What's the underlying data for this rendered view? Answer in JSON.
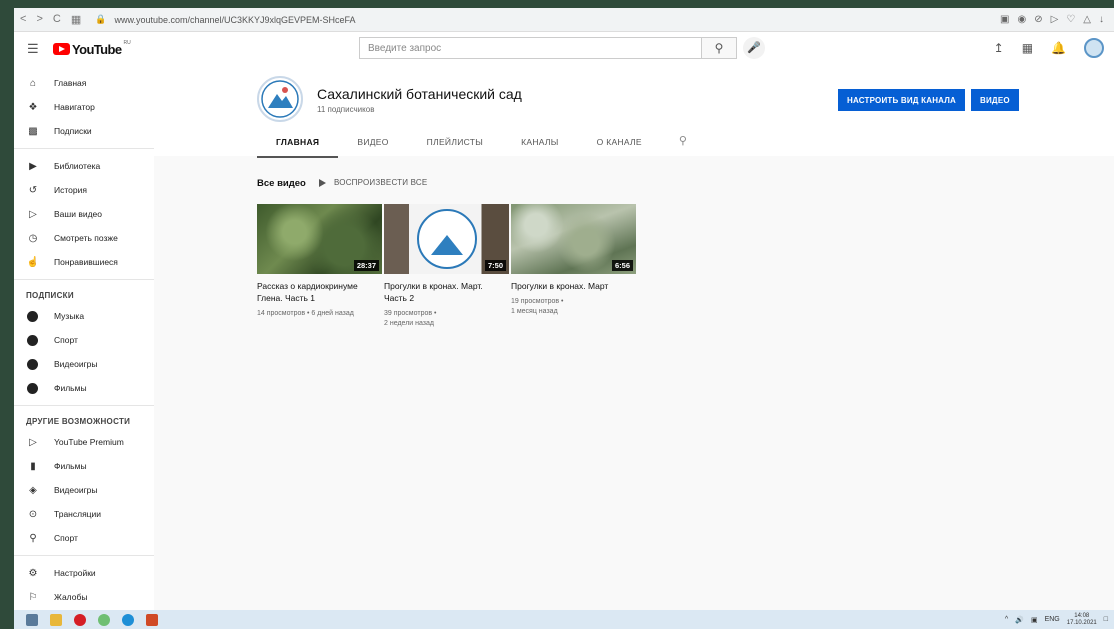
{
  "browser": {
    "url": "www.youtube.com/channel/UC3KKYJ9xlqGEVPEM-SHceFA"
  },
  "header": {
    "logo_text": "YouTube",
    "logo_region": "RU",
    "search_placeholder": "Введите запрос"
  },
  "sidebar": {
    "main": [
      {
        "label": "Главная",
        "icon": "home-icon"
      },
      {
        "label": "Навигатор",
        "icon": "compass-icon"
      },
      {
        "label": "Подписки",
        "icon": "subscriptions-icon"
      }
    ],
    "library": [
      {
        "label": "Библиотека",
        "icon": "library-icon"
      },
      {
        "label": "История",
        "icon": "history-icon"
      },
      {
        "label": "Ваши видео",
        "icon": "your-videos-icon"
      },
      {
        "label": "Смотреть позже",
        "icon": "clock-icon"
      },
      {
        "label": "Понравившиеся",
        "icon": "thumbs-up-icon"
      }
    ],
    "subscriptions_heading": "ПОДПИСКИ",
    "subscriptions": [
      {
        "label": "Музыка"
      },
      {
        "label": "Спорт"
      },
      {
        "label": "Видеоигры"
      },
      {
        "label": "Фильмы"
      }
    ],
    "more_heading": "ДРУГИЕ ВОЗМОЖНОСТИ",
    "more": [
      {
        "label": "YouTube Premium",
        "icon": "youtube-premium-icon"
      },
      {
        "label": "Фильмы",
        "icon": "film-icon"
      },
      {
        "label": "Видеоигры",
        "icon": "gamepad-icon"
      },
      {
        "label": "Трансляции",
        "icon": "live-icon"
      },
      {
        "label": "Спорт",
        "icon": "trophy-icon"
      }
    ],
    "bottom": [
      {
        "label": "Настройки",
        "icon": "gear-icon"
      },
      {
        "label": "Жалобы",
        "icon": "flag-icon"
      }
    ]
  },
  "channel": {
    "name": "Сахалинский ботанический сад",
    "subscribers": "11 подписчиков",
    "customize_label": "НАСТРОИТЬ ВИД КАНАЛА",
    "video_label": "ВИДЕО",
    "tabs": [
      "ГЛАВНАЯ",
      "ВИДЕО",
      "ПЛЕЙЛИСТЫ",
      "КАНАЛЫ",
      "О КАНАЛЕ"
    ],
    "active_tab": "ГЛАВНАЯ"
  },
  "section": {
    "title": "Все видео",
    "play_all": "ВОСПРОИЗВЕСТИ ВСЕ"
  },
  "videos": [
    {
      "title": "Рассказ о кардиокринуме Глена. Часть 1",
      "duration": "28:37",
      "views": "14 просмотров",
      "age": "6 дней назад",
      "meta": "14 просмотров • 6 дней назад"
    },
    {
      "title": "Прогулки в кронах. Март. Часть 2",
      "duration": "7:50",
      "meta1": "39 просмотров •",
      "meta2": "2 недели назад"
    },
    {
      "title": "Прогулки в кронах. Март",
      "duration": "6:56",
      "meta1": "19 просмотров •",
      "meta2": "1 месяц назад"
    }
  ],
  "taskbar": {
    "lang": "ENG",
    "time": "14:08",
    "date": "17.10.2021"
  }
}
